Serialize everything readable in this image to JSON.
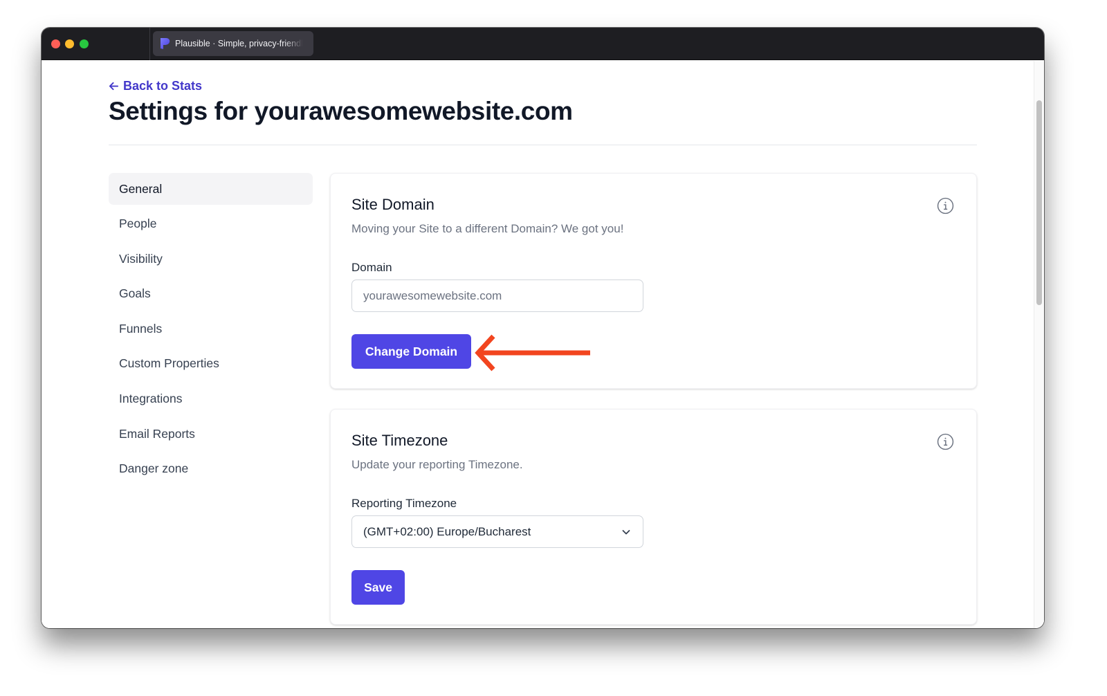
{
  "browser": {
    "tab_title": "Plausible · Simple, privacy-friendly analytics",
    "favicon": "plausible-logo-icon"
  },
  "header": {
    "back_link": "Back to Stats",
    "back_icon": "arrow-left-icon",
    "title": "Settings for yourawesomewebsite.com"
  },
  "sidebar": {
    "items": [
      {
        "label": "General",
        "active": true
      },
      {
        "label": "People",
        "active": false
      },
      {
        "label": "Visibility",
        "active": false
      },
      {
        "label": "Goals",
        "active": false
      },
      {
        "label": "Funnels",
        "active": false
      },
      {
        "label": "Custom Properties",
        "active": false
      },
      {
        "label": "Integrations",
        "active": false
      },
      {
        "label": "Email Reports",
        "active": false
      },
      {
        "label": "Danger zone",
        "active": false
      }
    ]
  },
  "site_domain": {
    "title": "Site Domain",
    "description": "Moving your Site to a different Domain? We got you!",
    "field_label": "Domain",
    "field_value": "yourawesomewebsite.com",
    "button_label": "Change Domain",
    "info_icon": "info-icon"
  },
  "site_timezone": {
    "title": "Site Timezone",
    "description": "Update your reporting Timezone.",
    "field_label": "Reporting Timezone",
    "selected_value": "(GMT+02:00) Europe/Bucharest",
    "button_label": "Save",
    "info_icon": "info-icon"
  },
  "colors": {
    "accent": "#4f46e5",
    "link": "#4338ca",
    "annotation_arrow": "#f2451f"
  }
}
